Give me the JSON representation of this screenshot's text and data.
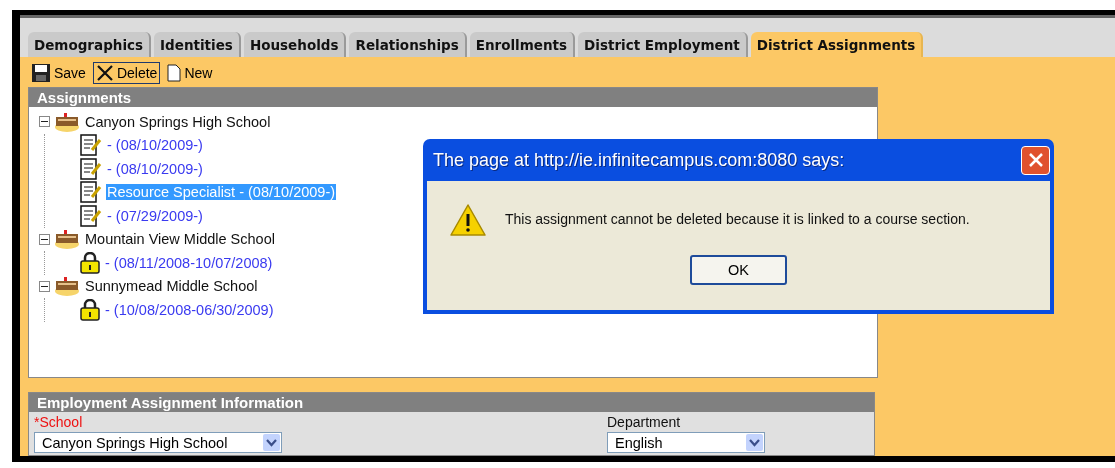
{
  "tabs": [
    {
      "label": "Demographics",
      "selected": false
    },
    {
      "label": "Identities",
      "selected": false
    },
    {
      "label": "Households",
      "selected": false
    },
    {
      "label": "Relationships",
      "selected": false
    },
    {
      "label": "Enrollments",
      "selected": false
    },
    {
      "label": "District Employment",
      "selected": false
    },
    {
      "label": "District Assignments",
      "selected": true
    }
  ],
  "toolbar": [
    {
      "label": "Save",
      "kind": "save",
      "focused": false
    },
    {
      "label": "Delete",
      "kind": "delete",
      "focused": true
    },
    {
      "label": "New",
      "kind": "new",
      "focused": false
    }
  ],
  "assignments": {
    "title": "Assignments",
    "tree": [
      {
        "label": "Canyon Springs High School",
        "kind": "school",
        "selected": false,
        "expanded": true,
        "children": [
          {
            "label": "- (08/10/2009-)",
            "kind": "editable",
            "selected": false
          },
          {
            "label": "- (08/10/2009-)",
            "kind": "editable",
            "selected": false
          },
          {
            "label": "Resource Specialist - (08/10/2009-)",
            "kind": "editable",
            "selected": true
          },
          {
            "label": "- (07/29/2009-)",
            "kind": "editable",
            "selected": false
          }
        ]
      },
      {
        "label": "Mountain View Middle School",
        "kind": "school",
        "selected": false,
        "expanded": true,
        "children": [
          {
            "label": "- (08/11/2008-10/07/2008)",
            "kind": "locked",
            "selected": false
          }
        ]
      },
      {
        "label": "Sunnymead Middle School",
        "kind": "school",
        "selected": false,
        "expanded": true,
        "children": [
          {
            "label": "- (10/08/2008-06/30/2009)",
            "kind": "locked",
            "selected": false
          }
        ]
      }
    ]
  },
  "dialog": {
    "title": "The page at http://ie.infinitecampus.com:8080 says:",
    "message": "This assignment cannot be deleted because it is linked to a course section.",
    "button": "OK"
  },
  "employment": {
    "title": "Employment Assignment Information",
    "fields": [
      {
        "label": "*School",
        "required": true,
        "value": "Canyon Springs High School"
      },
      {
        "label": "Department",
        "required": false,
        "value": "English"
      }
    ]
  }
}
